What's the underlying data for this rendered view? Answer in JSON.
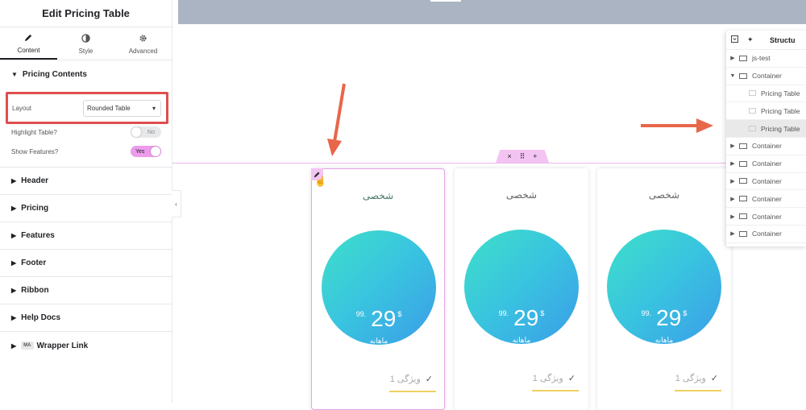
{
  "panel": {
    "title": "Edit Pricing Table",
    "tabs": [
      {
        "label": "Content",
        "icon": "pencil-icon"
      },
      {
        "label": "Style",
        "icon": "half-circle-icon"
      },
      {
        "label": "Advanced",
        "icon": "gear-icon"
      }
    ],
    "pricing_contents": {
      "title": "Pricing Contents",
      "layout_label": "Layout",
      "layout_value": "Rounded Table",
      "highlight_label": "Highlight Table?",
      "highlight_state": "No",
      "features_label": "Show Features?",
      "features_state": "Yes"
    },
    "sections": [
      "Header",
      "Pricing",
      "Features",
      "Footer",
      "Ribbon",
      "Help Docs"
    ],
    "wrapper_badge": "MA",
    "wrapper_label": "Wrapper Link"
  },
  "container_handle": {
    "close": "×",
    "drag": "⠿",
    "add": "+"
  },
  "cards": [
    {
      "title": "شخصی",
      "cents": "99.",
      "amount": "29",
      "currency": "$",
      "period": "ماهانه",
      "feature": "ویژگی 1"
    },
    {
      "title": "شخصی",
      "cents": "99.",
      "amount": "29",
      "currency": "$",
      "period": "ماهانه",
      "feature": "ویژگی 1"
    },
    {
      "title": "شخصی",
      "cents": "99.",
      "amount": "29",
      "currency": "$",
      "period": "ماهانه",
      "feature": "ویژگی 1"
    }
  ],
  "structure": {
    "title": "Structu",
    "items": [
      {
        "label": "js-test",
        "kind": "container",
        "expanded": false
      },
      {
        "label": "Container",
        "kind": "container",
        "expanded": true
      },
      {
        "label": "Pricing Table",
        "kind": "widget"
      },
      {
        "label": "Pricing Table",
        "kind": "widget"
      },
      {
        "label": "Pricing Table",
        "kind": "widget",
        "active": true
      },
      {
        "label": "Container",
        "kind": "container",
        "expanded": false
      },
      {
        "label": "Container",
        "kind": "container",
        "expanded": false
      },
      {
        "label": "Container",
        "kind": "container",
        "expanded": false
      },
      {
        "label": "Container",
        "kind": "container",
        "expanded": false
      },
      {
        "label": "Container",
        "kind": "container",
        "expanded": false
      },
      {
        "label": "Container",
        "kind": "container",
        "expanded": false
      }
    ],
    "more": "..."
  },
  "colors": {
    "highlight_border": "#e04e4e",
    "arrow": "#e8664a",
    "selection_pink": "#f3c4f2",
    "switch_on": "#ec9ceb",
    "circle_gradient": [
      "#3ee0c9",
      "#39c3e0",
      "#3b9de8"
    ],
    "feature_underline": "#f0d060"
  }
}
